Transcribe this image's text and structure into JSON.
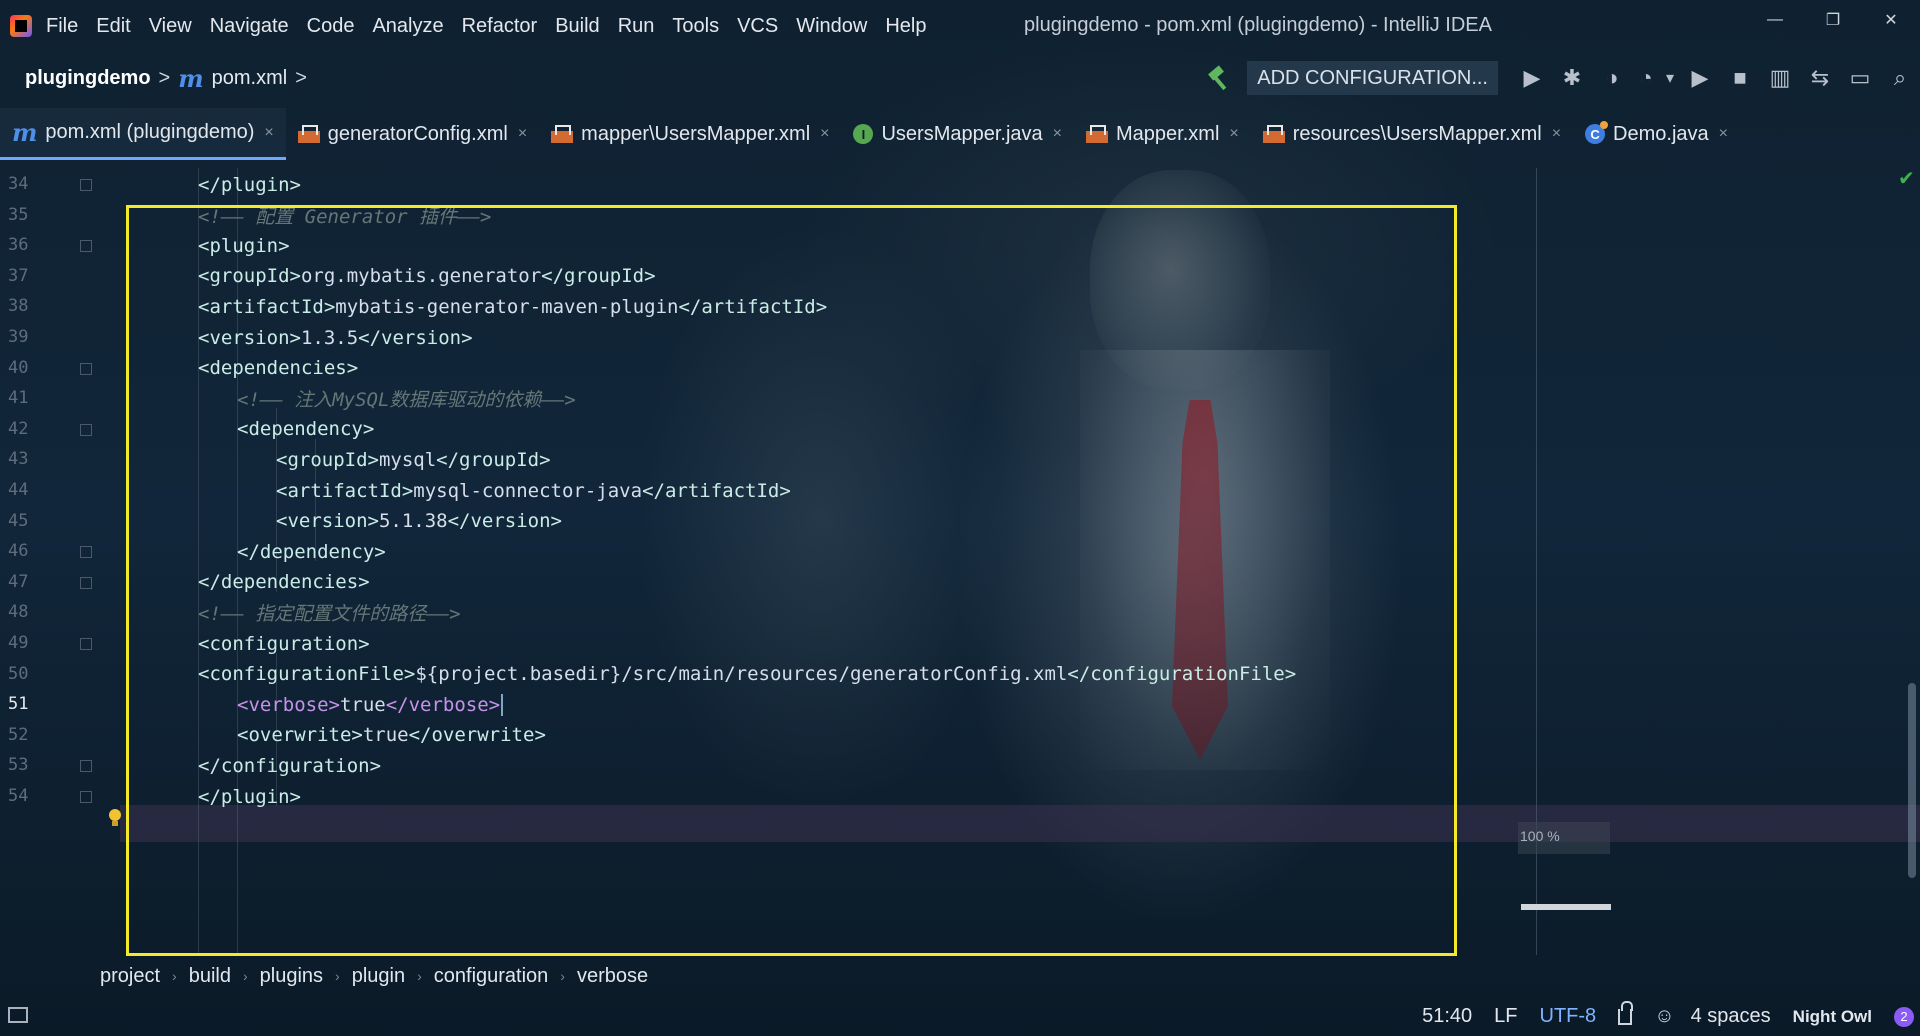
{
  "menu": {
    "items": [
      "File",
      "Edit",
      "View",
      "Navigate",
      "Code",
      "Analyze",
      "Refactor",
      "Build",
      "Run",
      "Tools",
      "VCS",
      "Window",
      "Help"
    ]
  },
  "window": {
    "title": "plugingdemo - pom.xml (plugingdemo) - IntelliJ IDEA",
    "minimize": "—",
    "restore": "❐",
    "close": "✕"
  },
  "nav": {
    "project": "plugingdemo",
    "sep": ">",
    "file_icon": "m",
    "file": "pom.xml",
    "add_config": "ADD CONFIGURATION...",
    "icons": {
      "run": "▶",
      "debug": "✱",
      "coverage": "◑",
      "profile": "◔",
      "dropdown": "▾",
      "run2": "▶",
      "stop": "■",
      "structure": "▥",
      "translate": "⇆",
      "terminal": "▭",
      "search": "⌕"
    }
  },
  "tabs": [
    {
      "label": "pom.xml (plugingdemo)",
      "icon": "maven-icon",
      "active": true
    },
    {
      "label": "generatorConfig.xml",
      "icon": "xml-icon"
    },
    {
      "label": "mapper\\UsersMapper.xml",
      "icon": "xml-icon"
    },
    {
      "label": "UsersMapper.java",
      "icon": "interface-icon"
    },
    {
      "label": "Mapper.xml",
      "icon": "xml-icon"
    },
    {
      "label": "resources\\UsersMapper.xml",
      "icon": "xml-icon"
    },
    {
      "label": "Demo.java",
      "icon": "class-icon"
    }
  ],
  "tab_close": "×",
  "tab_icon_text": {
    "interface": "I",
    "class": "C",
    "maven": "m"
  },
  "editor": {
    "lines": [
      {
        "num": "34",
        "indent": 2,
        "parts": [
          [
            "tag",
            "</plugin>"
          ]
        ]
      },
      {
        "num": "35",
        "indent": 2,
        "parts": [
          [
            "cmt",
            "<!—— 配置 Generator 插件——>"
          ]
        ]
      },
      {
        "num": "36",
        "indent": 2,
        "parts": [
          [
            "tag",
            "<plugin>"
          ]
        ]
      },
      {
        "num": "37",
        "indent": 2,
        "parts": [
          [
            "tag",
            "<groupId>"
          ],
          [
            "txt",
            "org.mybatis.generator"
          ],
          [
            "tag",
            "</groupId>"
          ]
        ]
      },
      {
        "num": "38",
        "indent": 2,
        "parts": [
          [
            "tag",
            "<artifactId>"
          ],
          [
            "txt",
            "mybatis-generator-maven-plugin"
          ],
          [
            "tag",
            "</artifactId>"
          ]
        ]
      },
      {
        "num": "39",
        "indent": 2,
        "parts": [
          [
            "tag",
            "<version>"
          ],
          [
            "txt",
            "1.3.5"
          ],
          [
            "tag",
            "</version>"
          ]
        ]
      },
      {
        "num": "40",
        "indent": 2,
        "parts": [
          [
            "tag",
            "<dependencies>"
          ]
        ]
      },
      {
        "num": "41",
        "indent": 3,
        "parts": [
          [
            "cmt",
            "<!—— 注入MySQL数据库驱动的依赖——>"
          ]
        ]
      },
      {
        "num": "42",
        "indent": 3,
        "parts": [
          [
            "tag",
            "<dependency>"
          ]
        ]
      },
      {
        "num": "43",
        "indent": 4,
        "parts": [
          [
            "tag",
            "<groupId>"
          ],
          [
            "txt",
            "mysql"
          ],
          [
            "tag",
            "</groupId>"
          ]
        ]
      },
      {
        "num": "44",
        "indent": 4,
        "parts": [
          [
            "tag",
            "<artifactId>"
          ],
          [
            "txt",
            "mysql-connector-java"
          ],
          [
            "tag",
            "</artifactId>"
          ]
        ]
      },
      {
        "num": "45",
        "indent": 4,
        "parts": [
          [
            "tag",
            "<version>"
          ],
          [
            "txt",
            "5.1.38"
          ],
          [
            "tag",
            "</version>"
          ]
        ]
      },
      {
        "num": "46",
        "indent": 3,
        "parts": [
          [
            "tag",
            "</dependency>"
          ]
        ]
      },
      {
        "num": "47",
        "indent": 2,
        "parts": [
          [
            "tag",
            "</dependencies>"
          ]
        ]
      },
      {
        "num": "48",
        "indent": 2,
        "parts": [
          [
            "cmt",
            "<!—— 指定配置文件的路径——>"
          ]
        ]
      },
      {
        "num": "49",
        "indent": 2,
        "parts": [
          [
            "tag",
            "<configuration>"
          ]
        ]
      },
      {
        "num": "50",
        "indent": 2,
        "parts": [
          [
            "tag",
            "<configurationFile>"
          ],
          [
            "txt",
            "${project.basedir}/src/main/resources/generatorConfig.xml"
          ],
          [
            "tag",
            "</configurationFile>"
          ]
        ]
      },
      {
        "num": "51",
        "indent": 3,
        "current": true,
        "parts": [
          [
            "tag-b",
            "<verbose>"
          ],
          [
            "txt",
            "true"
          ],
          [
            "tag-b",
            "</verbose>"
          ]
        ]
      },
      {
        "num": "52",
        "indent": 3,
        "parts": [
          [
            "tag",
            "<overwrite>"
          ],
          [
            "txt",
            "true"
          ],
          [
            "tag",
            "</overwrite>"
          ]
        ]
      },
      {
        "num": "53",
        "indent": 2,
        "parts": [
          [
            "tag",
            "</configuration>"
          ]
        ]
      },
      {
        "num": "54",
        "indent": 2,
        "parts": [
          [
            "tag",
            "</plugin>"
          ]
        ]
      }
    ],
    "fold_lines": [
      "34",
      "36",
      "40",
      "42",
      "46",
      "47",
      "49",
      "53",
      "54"
    ],
    "zoom": "100 %",
    "inspection_ok": "✔"
  },
  "path": [
    "project",
    "build",
    "plugins",
    "plugin",
    "configuration",
    "verbose"
  ],
  "path_sep": "›",
  "status": {
    "position": "51:40",
    "line_sep": "LF",
    "encoding": "UTF-8",
    "indent": "4 spaces",
    "theme": "Night Owl",
    "notifications": "2",
    "agent": "☺"
  },
  "colors": {
    "tag": "#caece6",
    "tag_current": "#c792ea",
    "text": "#d6deeb",
    "comment": "#637777",
    "highlight_box": "#f2ea2a",
    "accent": "#7fb3ff"
  }
}
